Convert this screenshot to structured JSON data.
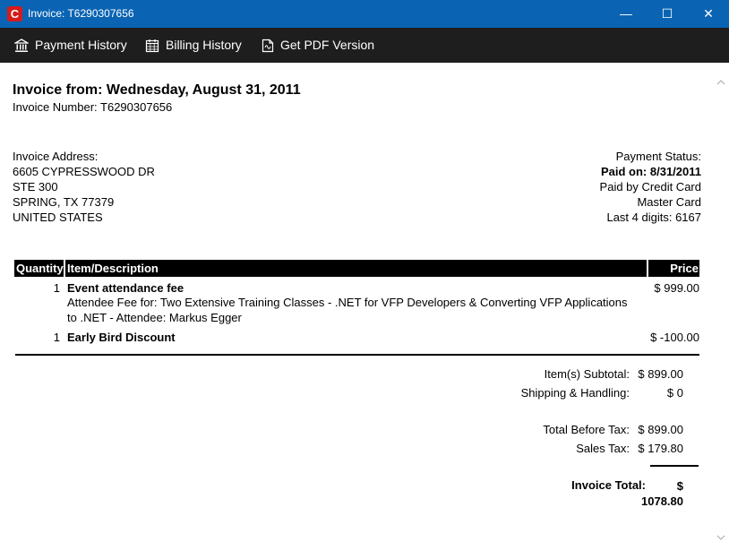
{
  "window": {
    "title": "Invoice: T6290307656",
    "app_icon_letter": "C",
    "accent": "#0a64b3",
    "minimize_glyph": "—",
    "maximize_glyph": "☐",
    "close_glyph": "✕"
  },
  "toolbar": {
    "items": [
      {
        "label": "Payment History",
        "icon": "bank-icon"
      },
      {
        "label": "Billing History",
        "icon": "calendar-icon"
      },
      {
        "label": "Get PDF Version",
        "icon": "document-icon"
      }
    ]
  },
  "invoice": {
    "title": "Invoice from: Wednesday, August 31, 2011",
    "number_line": "Invoice Number: T6290307656",
    "address": {
      "label": "Invoice Address:",
      "lines": [
        "6605 CYPRESSWOOD DR",
        "STE 300",
        "SPRING, TX 77379",
        "UNITED STATES"
      ]
    },
    "payment": {
      "label": "Payment Status:",
      "paid_on": "Paid on: 8/31/2011",
      "method": "Paid by Credit Card",
      "card": "Master Card",
      "last4": "Last 4 digits: 6167"
    },
    "table": {
      "headers": {
        "quantity": "Quantity",
        "description": "Item/Description",
        "price": "Price"
      },
      "rows": [
        {
          "qty": "1",
          "title": "Event attendance fee",
          "detail": "Attendee Fee for: Two Extensive Training Classes - .NET for VFP Developers & Converting VFP Applications to .NET - Attendee: Markus Egger",
          "price": "$ 999.00"
        },
        {
          "qty": "1",
          "title": "Early Bird Discount",
          "detail": "",
          "price": "$ -100.00"
        }
      ]
    },
    "totals": {
      "subtotal_label": "Item(s) Subtotal:",
      "subtotal": "$ 899.00",
      "shipping_label": "Shipping & Handling:",
      "shipping": "$ 0",
      "before_tax_label": "Total Before Tax:",
      "before_tax": "$ 899.00",
      "tax_label": "Sales Tax:",
      "tax": "$ 179.80",
      "total_label": "Invoice Total:",
      "total": "$ 1078.80"
    }
  }
}
